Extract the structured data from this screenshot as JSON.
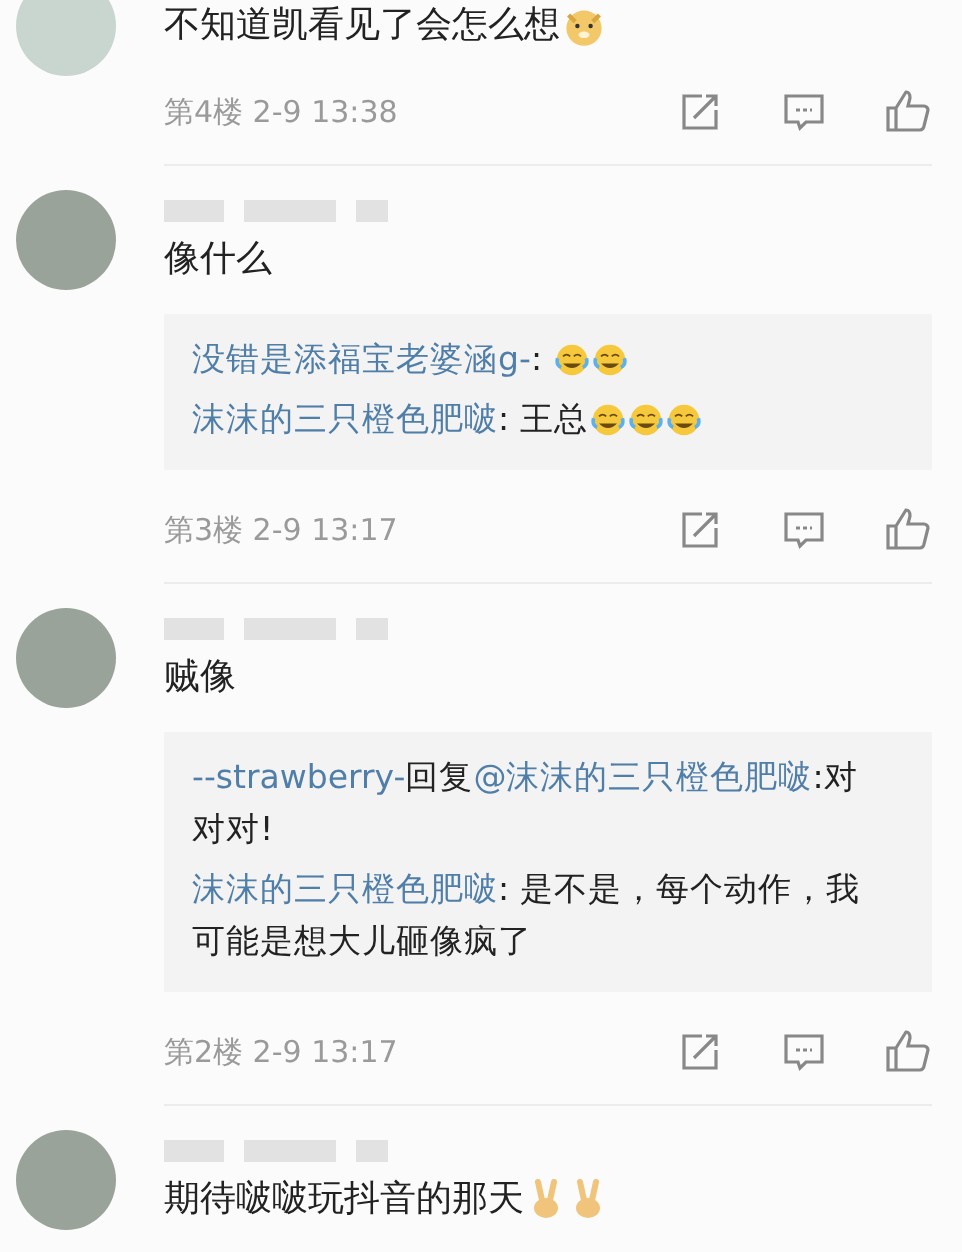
{
  "comments": [
    {
      "name_hidden": false,
      "text": "不知道凯看见了会怎么想",
      "emojis": [
        {
          "kind": "doge"
        }
      ],
      "meta": "第4楼 2-9 13:38"
    },
    {
      "name_hidden": true,
      "text": "像什么",
      "replies": [
        {
          "segments": [
            {
              "kind": "user",
              "text": "没错是添福宝老婆涵g-"
            },
            {
              "kind": "plain",
              "text": ": "
            }
          ],
          "emojis": [
            {
              "kind": "laugh-cry"
            },
            {
              "kind": "laugh-cry"
            }
          ]
        },
        {
          "segments": [
            {
              "kind": "user",
              "text": "沫沫的三只橙色肥啵"
            },
            {
              "kind": "plain",
              "text": ": 王总"
            }
          ],
          "emojis": [
            {
              "kind": "laugh-cry"
            },
            {
              "kind": "laugh-cry"
            },
            {
              "kind": "laugh-cry"
            }
          ]
        }
      ],
      "meta": "第3楼 2-9 13:17"
    },
    {
      "name_hidden": true,
      "text": "贼像",
      "replies": [
        {
          "segments": [
            {
              "kind": "user",
              "text": "--strawberry-"
            },
            {
              "kind": "plain",
              "text": "回复"
            },
            {
              "kind": "user",
              "text": "@沫沫的三只橙色肥啵"
            },
            {
              "kind": "plain",
              "text": ":对对对!"
            }
          ]
        },
        {
          "segments": [
            {
              "kind": "user",
              "text": "沫沫的三只橙色肥啵"
            },
            {
              "kind": "plain",
              "text": ": 是不是，每个动作，我可能是想大儿砸像疯了"
            }
          ]
        }
      ],
      "meta": "第2楼 2-9 13:17"
    },
    {
      "name_hidden": true,
      "text": "期待啵啵玩抖音的那天",
      "emojis": [
        {
          "kind": "victory"
        },
        {
          "kind": "victory"
        }
      ]
    }
  ]
}
